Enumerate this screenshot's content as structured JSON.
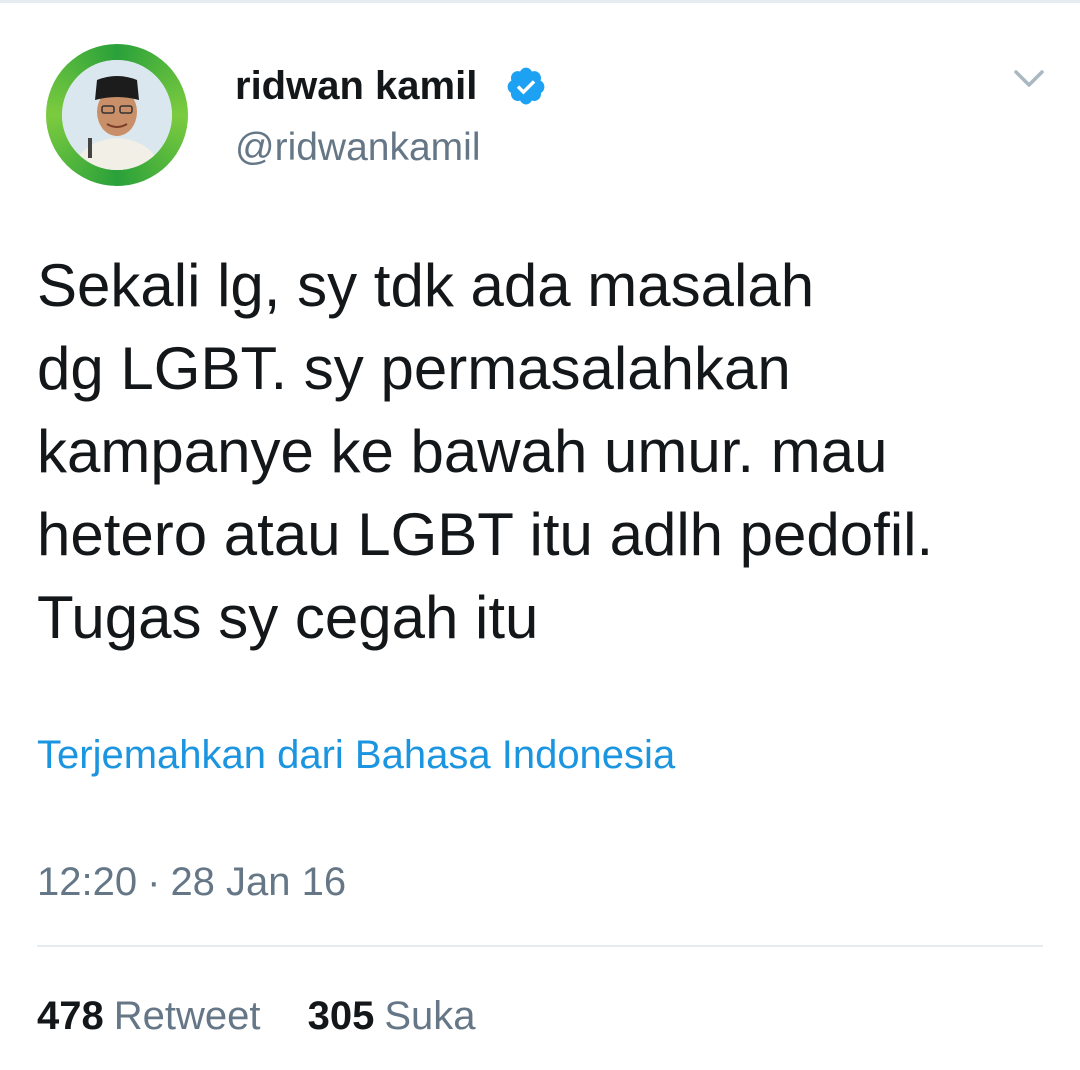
{
  "tweet": {
    "user": {
      "display_name": "ridwan kamil",
      "handle": "@ridwankamil",
      "verified": true
    },
    "text_lines": [
      "Sekali lg, sy tdk ada masalah",
      "dg LGBT. sy permasalahkan",
      "kampanye ke bawah umur. mau",
      "hetero atau LGBT itu adlh pedofil.",
      "Tugas sy cegah itu"
    ],
    "translate_label": "Terjemahkan dari Bahasa Indonesia",
    "time": "12:20",
    "separator": "·",
    "date": "28 Jan 16",
    "stats": {
      "retweets_count": "478",
      "retweets_label": "Retweet",
      "likes_count": "305",
      "likes_label": "Suka"
    }
  },
  "icons": {
    "verified": "verified-badge-icon",
    "caret": "chevron-down-icon",
    "avatar": "profile-avatar"
  },
  "colors": {
    "text": "#14171a",
    "secondary": "#657786",
    "link": "#1b95e0",
    "verified": "#1da1f2",
    "avatar_ring": "#2aa13a"
  }
}
